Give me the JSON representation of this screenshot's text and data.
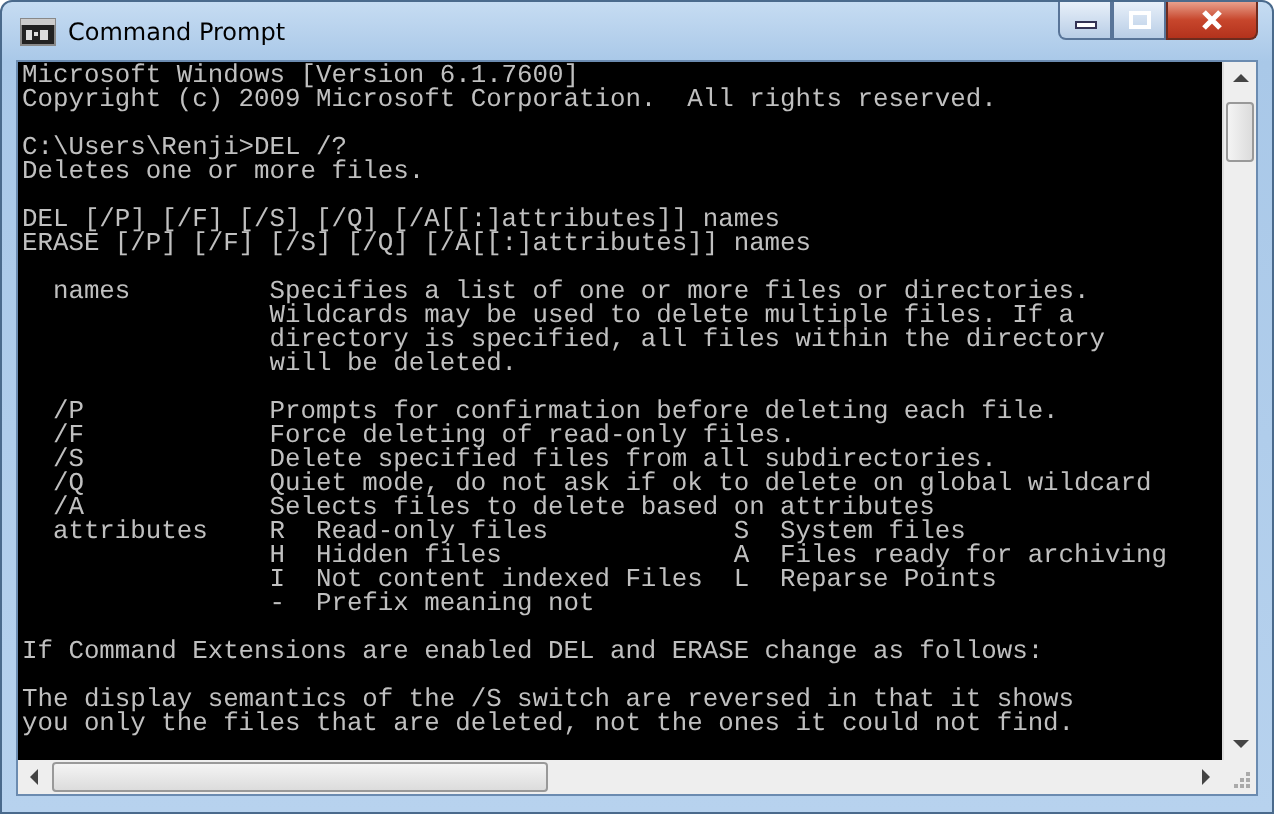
{
  "window": {
    "title": "Command Prompt"
  },
  "console": {
    "blocks": [
      [
        "Microsoft Windows [Version 6.1.7600]",
        "Copyright (c) 2009 Microsoft Corporation.  All rights reserved."
      ],
      [
        "C:\\Users\\Renji>DEL /?",
        "Deletes one or more files."
      ],
      [
        "DEL [/P] [/F] [/S] [/Q] [/A[[:]attributes]] names",
        "ERASE [/P] [/F] [/S] [/Q] [/A[[:]attributes]] names"
      ],
      [
        "  names         Specifies a list of one or more files or directories.",
        "                Wildcards may be used to delete multiple files. If a",
        "                directory is specified, all files within the directory",
        "                will be deleted."
      ],
      [
        "  /P            Prompts for confirmation before deleting each file.",
        "  /F            Force deleting of read-only files.",
        "  /S            Delete specified files from all subdirectories.",
        "  /Q            Quiet mode, do not ask if ok to delete on global wildcard",
        "  /A            Selects files to delete based on attributes",
        "  attributes    R  Read-only files            S  System files",
        "                H  Hidden files               A  Files ready for archiving",
        "                I  Not content indexed Files  L  Reparse Points",
        "                -  Prefix meaning not"
      ],
      [
        "If Command Extensions are enabled DEL and ERASE change as follows:"
      ],
      [
        "The display semantics of the /S switch are reversed in that it shows",
        "you only the files that are deleted, not the ones it could not find."
      ]
    ]
  }
}
